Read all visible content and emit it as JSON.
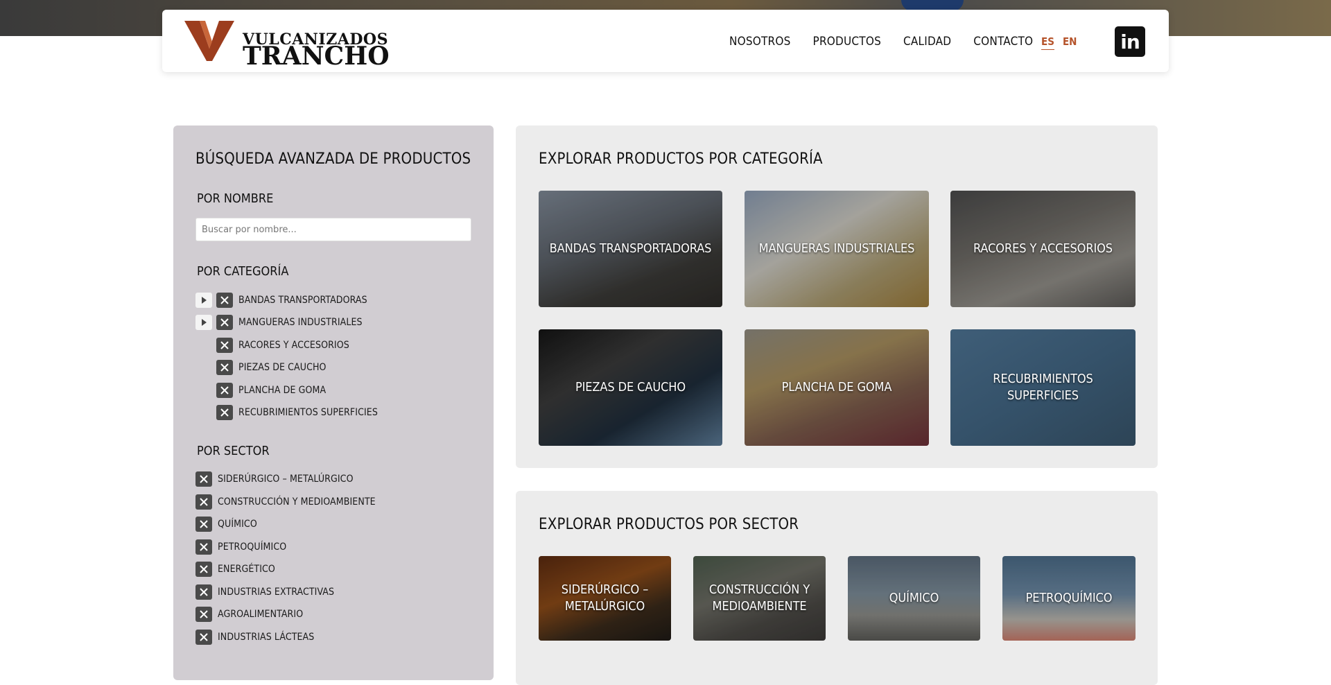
{
  "header": {
    "logo_line1": "VULCANIZADOS",
    "logo_line2": "TRANCHO",
    "nav": [
      "NOSOTROS",
      "PRODUCTOS",
      "CALIDAD",
      "CONTACTO"
    ],
    "lang_es": "ES",
    "lang_en": "EN",
    "linkedin_label": "in"
  },
  "sidebar": {
    "title": "BÚSQUEDA AVANZADA DE PRODUCTOS",
    "by_name": "POR NOMBRE",
    "search_placeholder": "Buscar por nombre...",
    "by_category": "POR CATEGORÍA",
    "categories": [
      {
        "label": "BANDAS TRANSPORTADORAS",
        "expandable": true
      },
      {
        "label": "MANGUERAS INDUSTRIALES",
        "expandable": true
      },
      {
        "label": "RACORES Y ACCESORIOS",
        "expandable": false
      },
      {
        "label": "PIEZAS DE CAUCHO",
        "expandable": false
      },
      {
        "label": "PLANCHA DE GOMA",
        "expandable": false
      },
      {
        "label": "RECUBRIMIENTOS SUPERFICIES",
        "expandable": false
      }
    ],
    "by_sector": "POR SECTOR",
    "sectors": [
      "SIDERÚRGICO – METALÚRGICO",
      "CONSTRUCCIÓN Y MEDIOAMBIENTE",
      "QUÍMICO",
      "PETROQUÍMICO",
      "ENERGÉTICO",
      "INDUSTRIAS EXTRACTIVAS",
      "AGROALIMENTARIO",
      "INDUSTRIAS LÁCTEAS"
    ]
  },
  "category_panel": {
    "title": "EXPLORAR PRODUCTOS POR CATEGORÍA",
    "tiles": [
      "BANDAS TRANSPORTADORAS",
      "MANGUERAS INDUSTRIALES",
      "RACORES Y ACCESORIOS",
      "PIEZAS DE CAUCHO",
      "PLANCHA DE GOMA",
      "RECUBRIMIENTOS SUPERFICIES"
    ]
  },
  "sector_panel": {
    "title": "EXPLORAR PRODUCTOS POR SECTOR",
    "tiles": [
      "SIDERÚRGICO – METALÚRGICO",
      "CONSTRUCCIÓN Y MEDIOAMBIENTE",
      "QUÍMICO",
      "PETROQUÍMICO"
    ]
  },
  "colors": {
    "accent": "#b5532a",
    "sidebar_bg": "#d1cdd2",
    "panel_bg": "#ececec",
    "x_button": "#4a4a4a"
  }
}
